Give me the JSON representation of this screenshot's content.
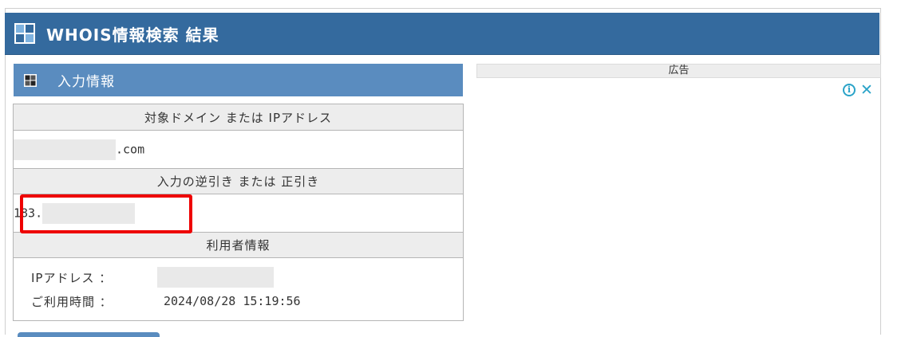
{
  "header": {
    "title": "WHOIS情報検索 結果",
    "icon": "grid-icon"
  },
  "input_section": {
    "title": "入力情報",
    "icon": "grid-icon"
  },
  "table": {
    "domain_header": "対象ドメイン または IPアドレス",
    "domain_value_suffix": ".com",
    "reverse_header": "入力の逆引き または 正引き",
    "reverse_value_prefix": "183.",
    "user_header": "利用者情報",
    "ip_label": "IPアドレス ：",
    "time_label": "ご利用時間 ：",
    "time_value": "2024/08/28 15:19:56"
  },
  "ad": {
    "label": "広告",
    "info_icon": "i",
    "close_icon": "✕",
    "accent_color": "#2aa3c8"
  },
  "colors": {
    "header_bg": "#346a9e",
    "section_bg": "#5a8cbf",
    "highlight_border": "#ee0000"
  }
}
